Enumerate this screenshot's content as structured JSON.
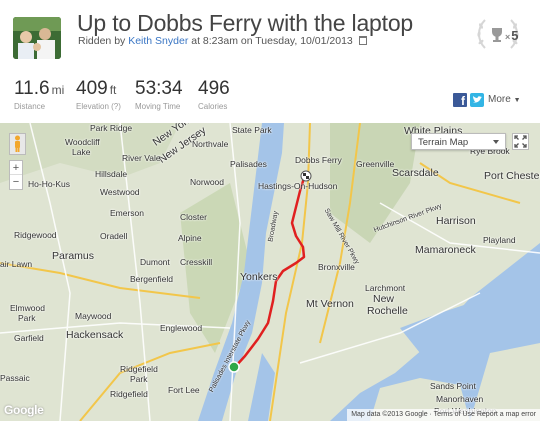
{
  "activity": {
    "title": "Up to Dobbs Ferry with the laptop",
    "ridden_prefix": "Ridden by",
    "rider": "Keith Snyder",
    "ridden_suffix": "at 8:23am on Tuesday, 10/01/2013"
  },
  "achievements": {
    "count": "5"
  },
  "stats": [
    {
      "value": "11.6",
      "unit": "mi",
      "label": "Distance"
    },
    {
      "value": "409",
      "unit": "ft",
      "label": "Elevation (?)"
    },
    {
      "value": "53:34",
      "unit": "",
      "label": "Moving Time"
    },
    {
      "value": "496",
      "unit": "",
      "label": "Calories"
    }
  ],
  "share": {
    "facebook": "f",
    "more_label": "More"
  },
  "map": {
    "type_selector": "Terrain Map",
    "zoom_in": "+",
    "zoom_out": "−",
    "attribution": "Map data ©2013 Google · Terms of Use  Report a map error",
    "logo": "Google",
    "route_color": "#e02020",
    "labels": {
      "new_york": "New York",
      "new_jersey": "New Jersey",
      "park_ridge": "Park Ridge",
      "woodcliff": "Woodcliff",
      "lake": "Lake",
      "state_park": "State Park",
      "dobbs_ferry": "Dobbs Ferry",
      "white_plains": "White Plains",
      "rye_brook": "Rye Brook",
      "river_vale": "River Vale",
      "northvale": "Northvale",
      "hillsdale": "Hillsdale",
      "norwood": "Norwood",
      "palisades": "Palisades",
      "hastings": "Hastings-On-Hudson",
      "greenville": "Greenville",
      "scarsdale": "Scarsdale",
      "port_chester": "Port Chester",
      "hohokus": "Ho-Ho-Kus",
      "westwood": "Westwood",
      "emerson": "Emerson",
      "closter": "Closter",
      "harrison": "Harrison",
      "oradell": "Oradell",
      "alpine": "Alpine",
      "bronx_river_pkwy": "Hutchinson River Pkwy",
      "ridgewood": "Ridgewood",
      "mamaroneck": "Mamaroneck",
      "playland": "Playland",
      "paramus": "Paramus",
      "dumont": "Dumont",
      "cresskill": "Cresskill",
      "bronxville": "Bronxville",
      "fair_lawn": "air Lawn",
      "bergenfield": "Bergenfield",
      "yonkers": "Yonkers",
      "larchmont": "Larchmont",
      "mt_vernon": "Mt Vernon",
      "new_rochelle_1": "New",
      "new_rochelle_2": "Rochelle",
      "elmwood_park": "Elmwood",
      "elmwood_park2": "Park",
      "maywood": "Maywood",
      "englewood": "Englewood",
      "garfield": "Garfield",
      "hackensack": "Hackensack",
      "passaic": "Passaic",
      "ridgefield_park": "Ridgefield",
      "ridgefield_park2": "Park",
      "ridgefield": "Ridgefield",
      "fort_lee": "Fort Lee",
      "sands_point": "Sands Point",
      "manorhaven": "Manorhaven",
      "port_washington": "Port Washington",
      "broadway": "Broadway",
      "saw_mill": "Saw Mill River Pkwy",
      "palisades_pkwy": "Palisades Interstate Pkwy"
    }
  }
}
